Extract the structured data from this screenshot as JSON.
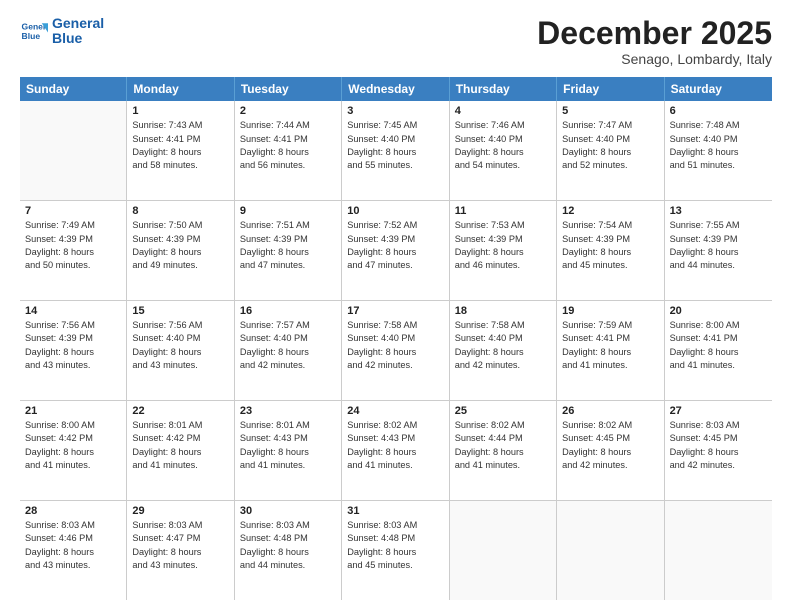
{
  "header": {
    "logo_general": "General",
    "logo_blue": "Blue",
    "month": "December 2025",
    "location": "Senago, Lombardy, Italy"
  },
  "days_of_week": [
    "Sunday",
    "Monday",
    "Tuesday",
    "Wednesday",
    "Thursday",
    "Friday",
    "Saturday"
  ],
  "weeks": [
    [
      {
        "day": "",
        "sunrise": "",
        "sunset": "",
        "daylight": ""
      },
      {
        "day": "1",
        "sunrise": "Sunrise: 7:43 AM",
        "sunset": "Sunset: 4:41 PM",
        "daylight": "Daylight: 8 hours and 58 minutes."
      },
      {
        "day": "2",
        "sunrise": "Sunrise: 7:44 AM",
        "sunset": "Sunset: 4:41 PM",
        "daylight": "Daylight: 8 hours and 56 minutes."
      },
      {
        "day": "3",
        "sunrise": "Sunrise: 7:45 AM",
        "sunset": "Sunset: 4:40 PM",
        "daylight": "Daylight: 8 hours and 55 minutes."
      },
      {
        "day": "4",
        "sunrise": "Sunrise: 7:46 AM",
        "sunset": "Sunset: 4:40 PM",
        "daylight": "Daylight: 8 hours and 54 minutes."
      },
      {
        "day": "5",
        "sunrise": "Sunrise: 7:47 AM",
        "sunset": "Sunset: 4:40 PM",
        "daylight": "Daylight: 8 hours and 52 minutes."
      },
      {
        "day": "6",
        "sunrise": "Sunrise: 7:48 AM",
        "sunset": "Sunset: 4:40 PM",
        "daylight": "Daylight: 8 hours and 51 minutes."
      }
    ],
    [
      {
        "day": "7",
        "sunrise": "Sunrise: 7:49 AM",
        "sunset": "Sunset: 4:39 PM",
        "daylight": "Daylight: 8 hours and 50 minutes."
      },
      {
        "day": "8",
        "sunrise": "Sunrise: 7:50 AM",
        "sunset": "Sunset: 4:39 PM",
        "daylight": "Daylight: 8 hours and 49 minutes."
      },
      {
        "day": "9",
        "sunrise": "Sunrise: 7:51 AM",
        "sunset": "Sunset: 4:39 PM",
        "daylight": "Daylight: 8 hours and 47 minutes."
      },
      {
        "day": "10",
        "sunrise": "Sunrise: 7:52 AM",
        "sunset": "Sunset: 4:39 PM",
        "daylight": "Daylight: 8 hours and 47 minutes."
      },
      {
        "day": "11",
        "sunrise": "Sunrise: 7:53 AM",
        "sunset": "Sunset: 4:39 PM",
        "daylight": "Daylight: 8 hours and 46 minutes."
      },
      {
        "day": "12",
        "sunrise": "Sunrise: 7:54 AM",
        "sunset": "Sunset: 4:39 PM",
        "daylight": "Daylight: 8 hours and 45 minutes."
      },
      {
        "day": "13",
        "sunrise": "Sunrise: 7:55 AM",
        "sunset": "Sunset: 4:39 PM",
        "daylight": "Daylight: 8 hours and 44 minutes."
      }
    ],
    [
      {
        "day": "14",
        "sunrise": "Sunrise: 7:56 AM",
        "sunset": "Sunset: 4:39 PM",
        "daylight": "Daylight: 8 hours and 43 minutes."
      },
      {
        "day": "15",
        "sunrise": "Sunrise: 7:56 AM",
        "sunset": "Sunset: 4:40 PM",
        "daylight": "Daylight: 8 hours and 43 minutes."
      },
      {
        "day": "16",
        "sunrise": "Sunrise: 7:57 AM",
        "sunset": "Sunset: 4:40 PM",
        "daylight": "Daylight: 8 hours and 42 minutes."
      },
      {
        "day": "17",
        "sunrise": "Sunrise: 7:58 AM",
        "sunset": "Sunset: 4:40 PM",
        "daylight": "Daylight: 8 hours and 42 minutes."
      },
      {
        "day": "18",
        "sunrise": "Sunrise: 7:58 AM",
        "sunset": "Sunset: 4:40 PM",
        "daylight": "Daylight: 8 hours and 42 minutes."
      },
      {
        "day": "19",
        "sunrise": "Sunrise: 7:59 AM",
        "sunset": "Sunset: 4:41 PM",
        "daylight": "Daylight: 8 hours and 41 minutes."
      },
      {
        "day": "20",
        "sunrise": "Sunrise: 8:00 AM",
        "sunset": "Sunset: 4:41 PM",
        "daylight": "Daylight: 8 hours and 41 minutes."
      }
    ],
    [
      {
        "day": "21",
        "sunrise": "Sunrise: 8:00 AM",
        "sunset": "Sunset: 4:42 PM",
        "daylight": "Daylight: 8 hours and 41 minutes."
      },
      {
        "day": "22",
        "sunrise": "Sunrise: 8:01 AM",
        "sunset": "Sunset: 4:42 PM",
        "daylight": "Daylight: 8 hours and 41 minutes."
      },
      {
        "day": "23",
        "sunrise": "Sunrise: 8:01 AM",
        "sunset": "Sunset: 4:43 PM",
        "daylight": "Daylight: 8 hours and 41 minutes."
      },
      {
        "day": "24",
        "sunrise": "Sunrise: 8:02 AM",
        "sunset": "Sunset: 4:43 PM",
        "daylight": "Daylight: 8 hours and 41 minutes."
      },
      {
        "day": "25",
        "sunrise": "Sunrise: 8:02 AM",
        "sunset": "Sunset: 4:44 PM",
        "daylight": "Daylight: 8 hours and 41 minutes."
      },
      {
        "day": "26",
        "sunrise": "Sunrise: 8:02 AM",
        "sunset": "Sunset: 4:45 PM",
        "daylight": "Daylight: 8 hours and 42 minutes."
      },
      {
        "day": "27",
        "sunrise": "Sunrise: 8:03 AM",
        "sunset": "Sunset: 4:45 PM",
        "daylight": "Daylight: 8 hours and 42 minutes."
      }
    ],
    [
      {
        "day": "28",
        "sunrise": "Sunrise: 8:03 AM",
        "sunset": "Sunset: 4:46 PM",
        "daylight": "Daylight: 8 hours and 43 minutes."
      },
      {
        "day": "29",
        "sunrise": "Sunrise: 8:03 AM",
        "sunset": "Sunset: 4:47 PM",
        "daylight": "Daylight: 8 hours and 43 minutes."
      },
      {
        "day": "30",
        "sunrise": "Sunrise: 8:03 AM",
        "sunset": "Sunset: 4:48 PM",
        "daylight": "Daylight: 8 hours and 44 minutes."
      },
      {
        "day": "31",
        "sunrise": "Sunrise: 8:03 AM",
        "sunset": "Sunset: 4:48 PM",
        "daylight": "Daylight: 8 hours and 45 minutes."
      },
      {
        "day": "",
        "sunrise": "",
        "sunset": "",
        "daylight": ""
      },
      {
        "day": "",
        "sunrise": "",
        "sunset": "",
        "daylight": ""
      },
      {
        "day": "",
        "sunrise": "",
        "sunset": "",
        "daylight": ""
      }
    ]
  ]
}
